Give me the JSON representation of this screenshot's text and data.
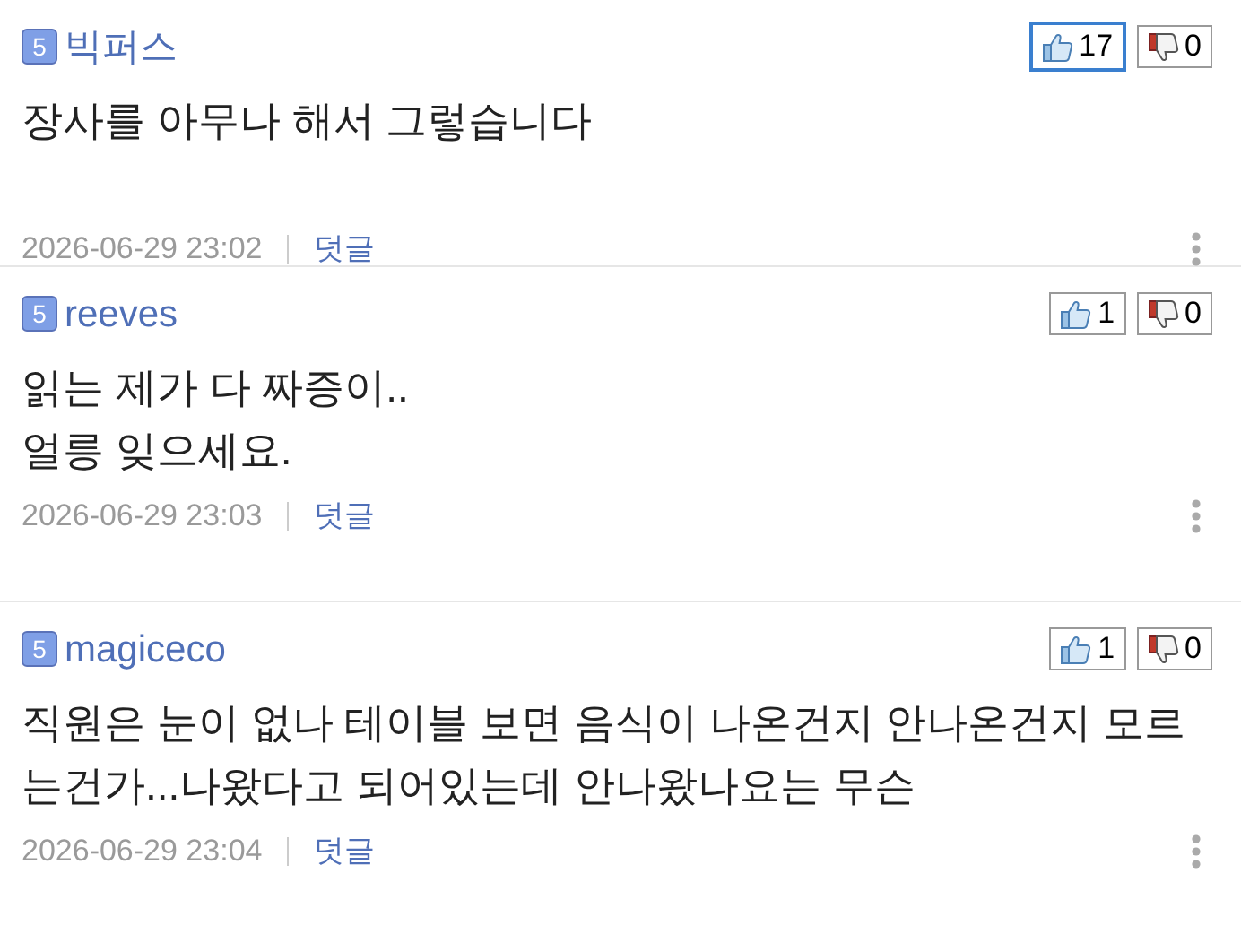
{
  "comments": [
    {
      "level_badge": "5",
      "author": "빅퍼스",
      "like": {
        "count": "17",
        "highlighted": true
      },
      "dislike": {
        "count": "0"
      },
      "lines": [
        "장사를 아무나 해서 그렇습니다"
      ],
      "time": "2026-06-29 23:02",
      "reply": "덧글"
    },
    {
      "level_badge": "5",
      "author": "reeves",
      "like": {
        "count": "1",
        "highlighted": false
      },
      "dislike": {
        "count": "0"
      },
      "lines": [
        "읽는 제가 다 짜증이..",
        "얼릉 잊으세요."
      ],
      "time": "2026-06-29 23:03",
      "reply": "덧글"
    },
    {
      "level_badge": "5",
      "author": "magiceco",
      "like": {
        "count": "1",
        "highlighted": false
      },
      "dislike": {
        "count": "0"
      },
      "lines": [
        "직원은 눈이 없나 테이블 보면 음식이 나온건지 안나온건지 모르는건가...나왔다고 되어있는데 안나왔나요는 무슨"
      ],
      "time": "2026-06-29 23:04",
      "reply": "덧글"
    }
  ]
}
